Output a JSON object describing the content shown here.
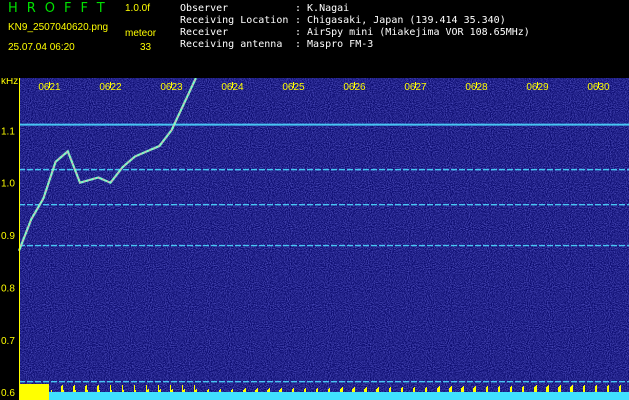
{
  "header": {
    "logo": "HROFFT",
    "version": "1.0.0f",
    "filename": "KN9_2507040620.png",
    "meteor_label": "meteor",
    "datetime": "25.07.04 06:20",
    "meteor_count": "33",
    "info": [
      {
        "key": "Observer",
        "value": ": K.Nagai"
      },
      {
        "key": "Receiving Location",
        "value": ": Chigasaki, Japan (139.414 35.340)"
      },
      {
        "key": "Receiver",
        "value": ": AirSpy mini (Miakejima VOR 108.65MHz)"
      },
      {
        "key": "Receiving antenna",
        "value": ": Maspro FM-3"
      }
    ]
  },
  "colors": {
    "background": "#000000",
    "label_yellow": "#ffff00",
    "logo_green": "#00e000",
    "spectrogram_bg": "#0a0a6e",
    "line_cyan": "#4cd8ff",
    "bottom_strip": "#40e0ff"
  },
  "chart_data": {
    "type": "heatmap",
    "ylabel": "kHz",
    "y_ticks": [
      "1.1",
      "1.0",
      "0.9",
      "0.8",
      "0.7",
      "0.6"
    ],
    "x_ticks": [
      "0621",
      "0622",
      "0623",
      "0624",
      "0625",
      "0626",
      "0627",
      "0628",
      "0629",
      "0630"
    ],
    "ylim": [
      0.585,
      1.2
    ],
    "xlim": [
      0,
      10
    ],
    "horizontal_lines_khz": [
      1.111,
      1.025,
      0.958,
      0.88,
      0.62
    ],
    "trace": [
      {
        "x": 0.0,
        "y": 0.87
      },
      {
        "x": 0.2,
        "y": 0.93
      },
      {
        "x": 0.4,
        "y": 0.97
      },
      {
        "x": 0.6,
        "y": 1.04
      },
      {
        "x": 0.8,
        "y": 1.06
      },
      {
        "x": 1.0,
        "y": 1.0
      },
      {
        "x": 1.3,
        "y": 1.01
      },
      {
        "x": 1.5,
        "y": 1.0
      },
      {
        "x": 1.7,
        "y": 1.03
      },
      {
        "x": 1.9,
        "y": 1.05
      },
      {
        "x": 2.1,
        "y": 1.06
      },
      {
        "x": 2.3,
        "y": 1.07
      },
      {
        "x": 2.5,
        "y": 1.1
      },
      {
        "x": 2.7,
        "y": 1.15
      },
      {
        "x": 2.9,
        "y": 1.2
      }
    ]
  }
}
